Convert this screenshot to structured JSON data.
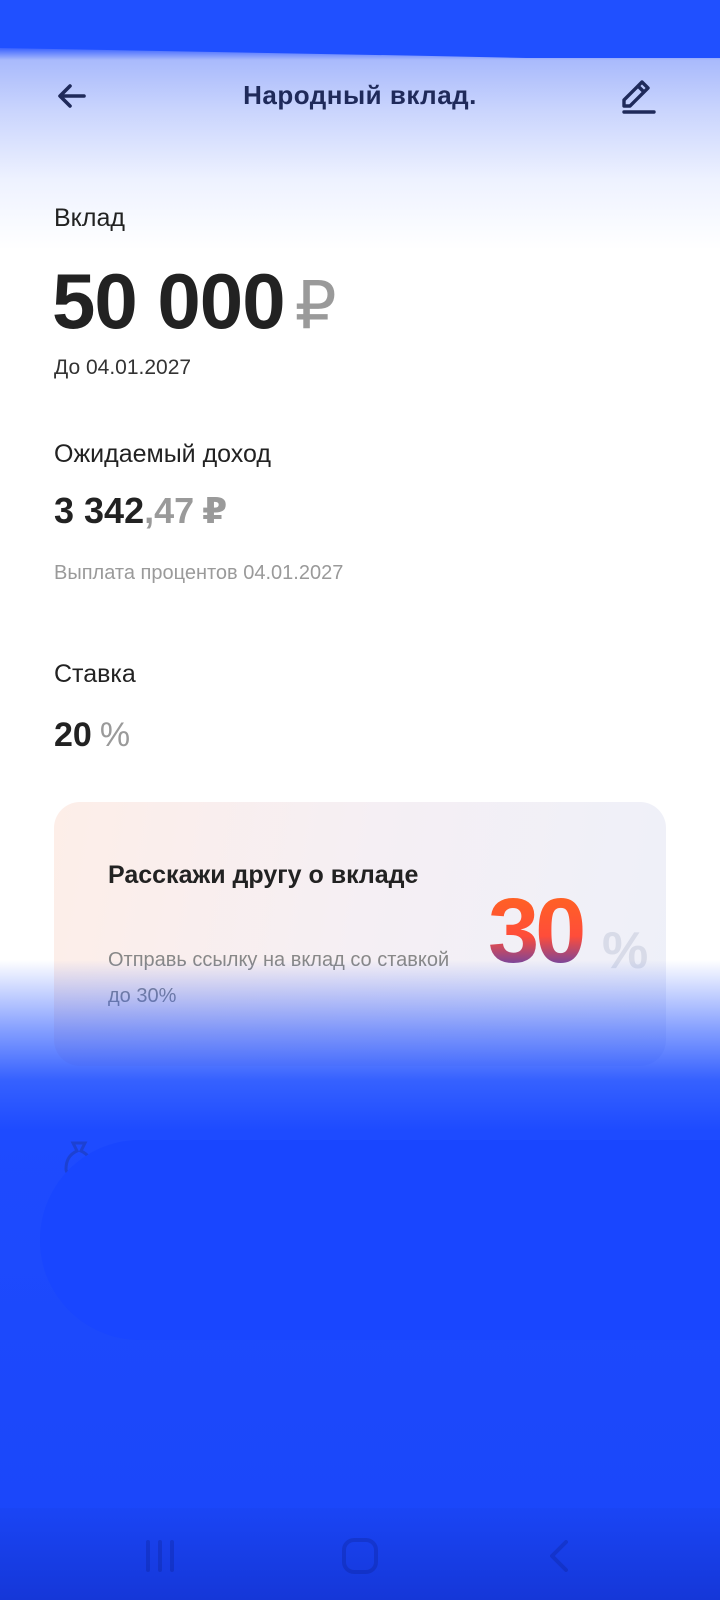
{
  "header": {
    "title": "Народный вклад.",
    "back_icon": "arrow-left-icon",
    "edit_icon": "pencil-icon"
  },
  "deposit": {
    "label": "Вклад",
    "amount": "50 000",
    "currency": "₽",
    "until": "До 04.01.2027"
  },
  "income": {
    "label": "Ожидаемый доход",
    "whole": "3 342",
    "fraction": ",47",
    "currency": "₽",
    "payout": "Выплата процентов 04.01.2027"
  },
  "rate": {
    "label": "Ставка",
    "value": "20",
    "unit": "%"
  },
  "promo": {
    "title": "Расскажи другу о вкладе",
    "text": "Отправь ссылку на вклад со ставкой до 30%",
    "art_value": "30",
    "art_unit": "%"
  },
  "colors": {
    "accent": "#2050ff",
    "title": "#1f2a5a",
    "muted": "#9a9a9a"
  }
}
